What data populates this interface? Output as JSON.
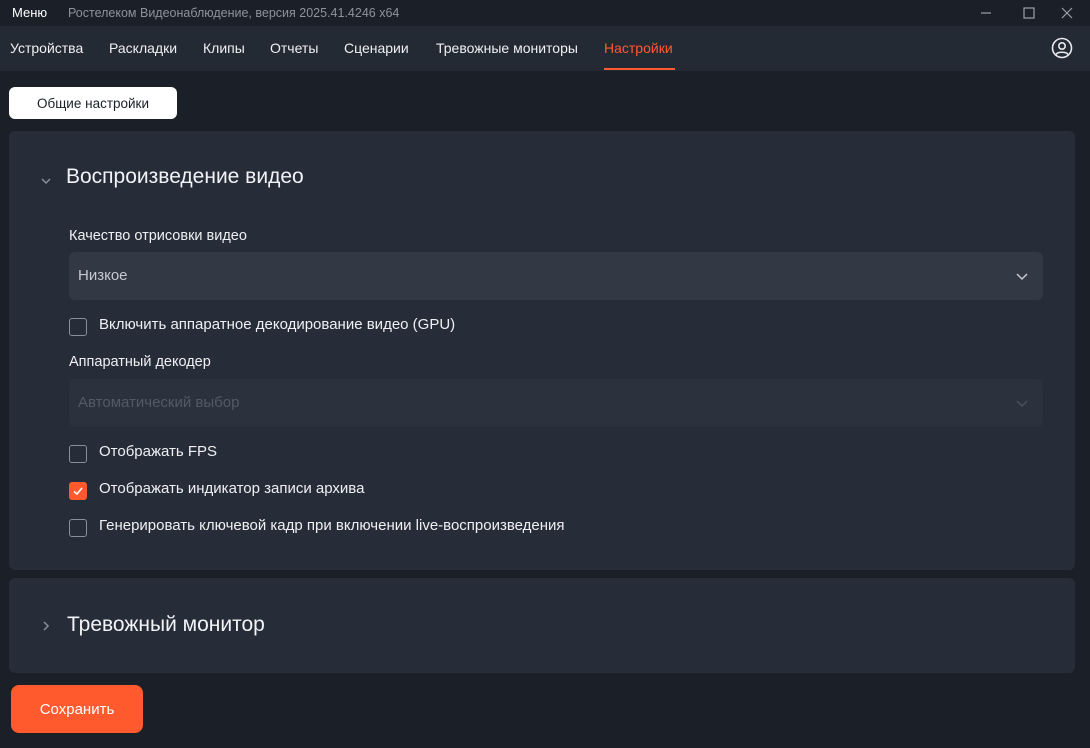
{
  "titlebar": {
    "menu_label": "Меню",
    "app_title": "Ростелеком Видеонаблюдение, версия 2025.41.4246 x64",
    "minimize": "—",
    "maximize": "☐",
    "close": "✕"
  },
  "nav": {
    "tabs": [
      {
        "label": "Устройства"
      },
      {
        "label": "Раскладки"
      },
      {
        "label": "Клипы"
      },
      {
        "label": "Отчеты"
      },
      {
        "label": "Сценарии"
      },
      {
        "label": "Тревожные мониторы"
      },
      {
        "label": "Настройки"
      }
    ],
    "active_tab": "Настройки",
    "user_icon": "user-circle-icon"
  },
  "general_settings_button": "Общие настройки",
  "video_section": {
    "title": "Воспроизведение видео",
    "expanded": true,
    "quality_label": "Качество отрисовки видео",
    "quality_value": "Низкое",
    "gpu_checkbox": {
      "label": "Включить аппаратное декодирование видео (GPU)",
      "checked": false
    },
    "decoder_label": "Аппаратный декодер",
    "decoder_value": "Автоматический выбор",
    "decoder_disabled": true,
    "fps_checkbox": {
      "label": "Отображать FPS",
      "checked": false
    },
    "archive_checkbox": {
      "label": "Отображать индикатор записи архива",
      "checked": true
    },
    "keyframe_checkbox": {
      "label": "Генерировать ключевой кадр при включении live-воспроизведения",
      "checked": false
    }
  },
  "alarm_section": {
    "title": "Тревожный монитор",
    "expanded": false
  },
  "save_button": "Сохранить",
  "colors": {
    "accent": "#ff5a2e",
    "background": "#1b1f27",
    "panel": "#272d38"
  }
}
